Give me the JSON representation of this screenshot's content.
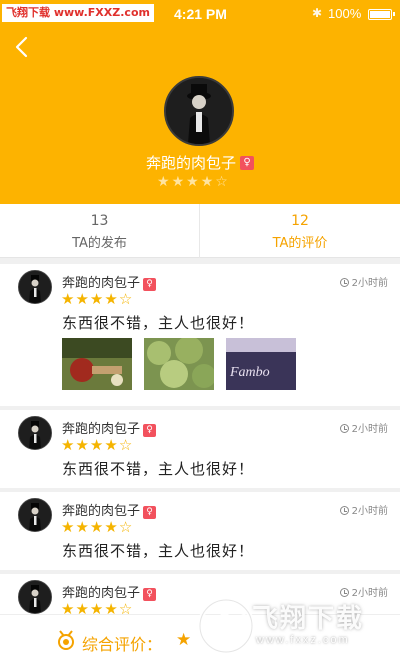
{
  "status_bar": {
    "watermark": "飞翔下载 www.FXXZ.com",
    "time": "4:21 PM",
    "battery": "100%"
  },
  "profile": {
    "name": "奔跑的肉包子",
    "gender_symbol": "♀",
    "rating": 4,
    "max_rating": 5
  },
  "tabs": [
    {
      "count": "13",
      "label": "TA的发布",
      "active": false
    },
    {
      "count": "12",
      "label": "TA的评价",
      "active": true
    }
  ],
  "reviews": [
    {
      "name": "奔跑的肉包子",
      "gender_symbol": "♀",
      "time": "2小时前",
      "rating": 4,
      "text": "东西很不错，主人也很好！",
      "photos": [
        "photo-1",
        "photo-2",
        "photo-3"
      ]
    },
    {
      "name": "奔跑的肉包子",
      "gender_symbol": "♀",
      "time": "2小时前",
      "rating": 4,
      "text": "东西很不错，主人也很好！"
    },
    {
      "name": "奔跑的肉包子",
      "gender_symbol": "♀",
      "time": "2小时前",
      "rating": 4,
      "text": "东西很不错，主人也很好！"
    },
    {
      "name": "奔跑的肉包子",
      "gender_symbol": "♀",
      "time": "2小时前",
      "rating": 4,
      "text": ""
    }
  ],
  "photo_3_text": "Fambo",
  "bottom_bar": {
    "label": "综合评价：",
    "star": "★"
  },
  "watermark_overlay": {
    "text": "飞翔下载",
    "url": "www.fxxz.com"
  },
  "colors": {
    "header": "#fdb300",
    "accent": "#f5a300",
    "star": "#f5b400",
    "gender_badge": "#f2515d"
  }
}
